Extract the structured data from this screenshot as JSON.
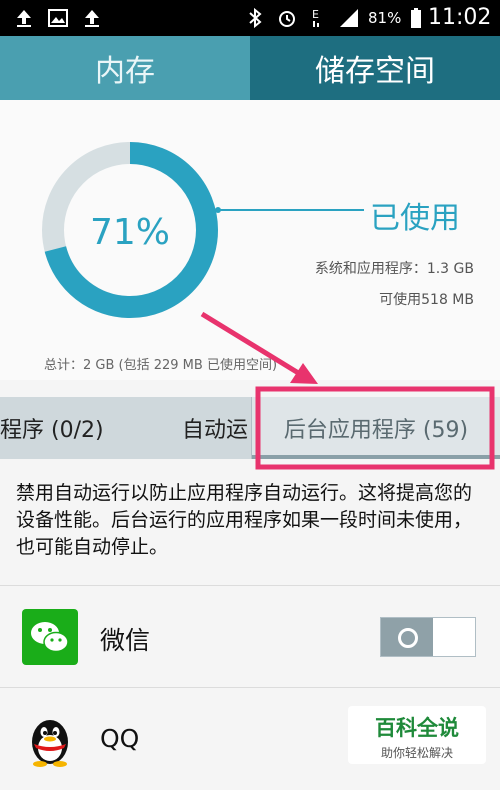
{
  "status_bar": {
    "battery": "81%",
    "time": "11:02"
  },
  "top_tabs": [
    {
      "label": "内存"
    },
    {
      "label": "储存空间"
    }
  ],
  "storage": {
    "percent_used": "71%",
    "used_fraction": 0.71,
    "used_label": "已使用",
    "system_apps": "系统和应用程序：1.3 GB",
    "available": "可使用518 MB",
    "total": "总计：2 GB (包括 229 MB 已使用空间)"
  },
  "sub_tabs": [
    {
      "label": "程序 (0/2)"
    },
    {
      "label": "自动运"
    },
    {
      "label": "后台应用程序 (59)"
    }
  ],
  "description": "禁用自动运行以防止应用程序自动运行。这将提高您的设备性能。后台运行的应用程序如果一段时间未使用，也可能自动停止。",
  "apps": [
    {
      "name": "微信",
      "toggle_on": false
    },
    {
      "name": "QQ"
    }
  ],
  "watermark": {
    "title": "百科全说",
    "subtitle": "助你轻松解决"
  },
  "colors": {
    "accent": "#2aa2c1",
    "highlight": "#e8336d",
    "tab_active": "#1e6e80",
    "tab_inactive": "#4a9fb0"
  }
}
